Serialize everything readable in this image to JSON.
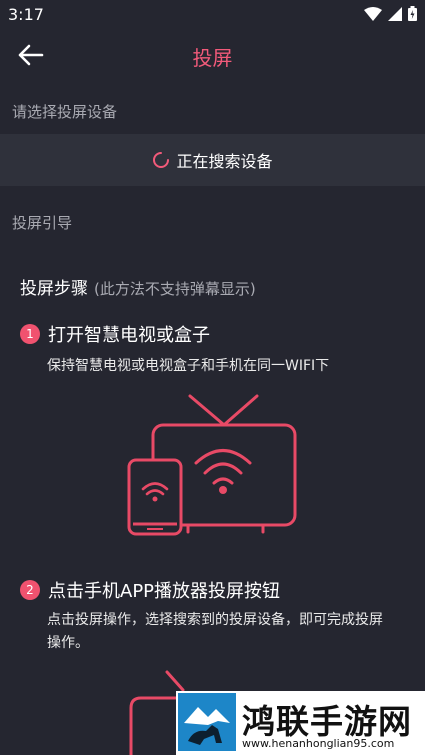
{
  "status": {
    "time": "3:17"
  },
  "header": {
    "title": "投屏"
  },
  "device_section": {
    "label": "请选择投屏设备",
    "search_text": "正在搜索设备"
  },
  "guide_section": {
    "label": "投屏引导"
  },
  "steps_header": {
    "title": "投屏步骤",
    "note": "(此方法不支持弹幕显示)"
  },
  "steps": [
    {
      "num": "1",
      "title": "打开智慧电视或盒子",
      "desc": "保持智慧电视或电视盒子和手机在同一WIFI下"
    },
    {
      "num": "2",
      "title": "点击手机APP播放器投屏按钮",
      "desc": "点击投屏操作，选择搜索到的投屏设备，即可完成投屏操作。"
    }
  ],
  "watermark": {
    "brand": "鸿联手游网",
    "url": "www.henanhonglian95.com"
  },
  "colors": {
    "accent": "#f25a7a",
    "background": "#252630"
  }
}
